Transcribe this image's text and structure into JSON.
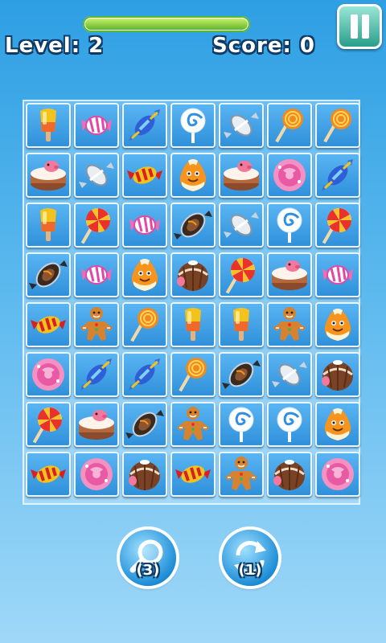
{
  "hud": {
    "level_label": "Level: 2",
    "score_label": "Score: 0",
    "time_remaining": 1.0
  },
  "board": {
    "rows": [
      [
        "popsicle",
        "wrapped-candy-pink",
        "wrapped-candy-blue",
        "swirl-lollipop-blue",
        "wrapped-candy-silver",
        "lollipop-orange",
        "lollipop-orange"
      ],
      [
        "pig-cake",
        "wrapped-candy-silver",
        "wrapped-candy-striped",
        "candy-corn",
        "pig-cake",
        "pink-cupcake",
        "wrapped-candy-blue"
      ],
      [
        "popsicle",
        "swirl-lollipop-red",
        "wrapped-candy-pink",
        "wrapped-chocolate",
        "wrapped-candy-silver",
        "swirl-lollipop-blue",
        "swirl-lollipop-red"
      ],
      [
        "wrapped-chocolate",
        "wrapped-candy-pink",
        "candy-corn",
        "choco-bonbon",
        "swirl-lollipop-red",
        "pig-cake",
        "wrapped-candy-pink"
      ],
      [
        "wrapped-candy-striped",
        "gingerbread-man",
        "lollipop-orange",
        "popsicle",
        "popsicle",
        "gingerbread-man",
        "candy-corn"
      ],
      [
        "pink-cupcake",
        "wrapped-candy-blue",
        "wrapped-candy-blue",
        "lollipop-orange",
        "wrapped-chocolate",
        "wrapped-candy-silver",
        "choco-bonbon"
      ],
      [
        "swirl-lollipop-red",
        "pig-cake",
        "wrapped-chocolate",
        "gingerbread-man",
        "swirl-lollipop-blue",
        "swirl-lollipop-blue",
        "candy-corn"
      ],
      [
        "wrapped-candy-striped",
        "pink-cupcake",
        "choco-bonbon",
        "wrapped-candy-striped",
        "gingerbread-man",
        "choco-bonbon",
        "pink-cupcake"
      ]
    ]
  },
  "buttons": {
    "hint": {
      "icon": "magnifier-icon",
      "count_label": "(3)"
    },
    "shuffle": {
      "icon": "refresh-icon",
      "count_label": "(1)"
    }
  },
  "colors": {
    "accent": "#2e9fe3",
    "pause": "#2a9e8b",
    "progress": "#5fb62a"
  }
}
